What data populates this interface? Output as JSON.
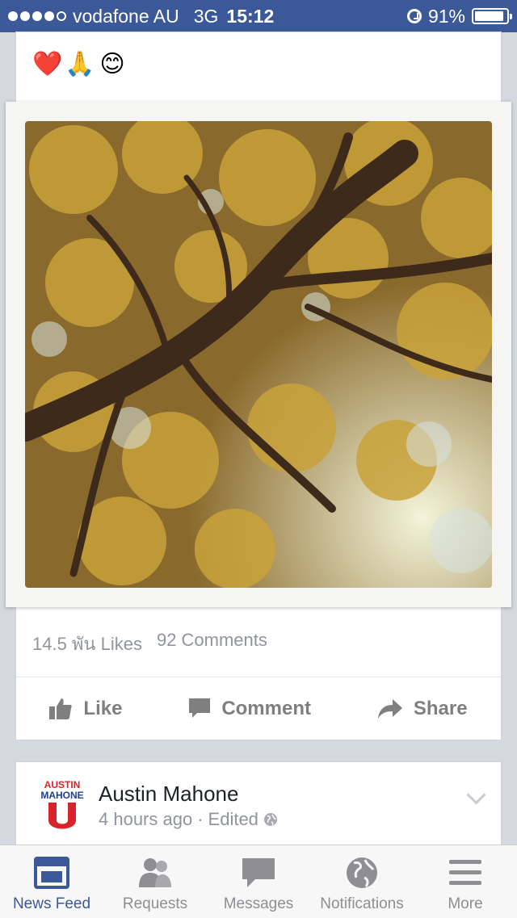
{
  "status_bar": {
    "carrier": "vodafone AU",
    "network": "3G",
    "time": "15:12",
    "battery": "91%",
    "battery_level": 0.91,
    "signal_strength": 4,
    "signal_max": 5,
    "alarm_icon": "alarm-clock-icon"
  },
  "post_top": {
    "emojis": [
      "❤️",
      "🙏",
      "😊"
    ],
    "likes": "14.5 พัน Likes",
    "comments": "92 Comments",
    "actions": {
      "like_label": "Like",
      "comment_label": "Comment",
      "share_label": "Share"
    }
  },
  "post_next": {
    "author": "Austin Mahone",
    "time": "4 hours ago",
    "separator": "·",
    "edited": "Edited",
    "avatar_text_top": "AUSTIN",
    "avatar_text_bottom": "MAHONE",
    "avatar_letter": "U"
  },
  "tabbar": {
    "tabs": [
      {
        "label": "News Feed",
        "icon": "news-feed-icon",
        "active": true
      },
      {
        "label": "Requests",
        "icon": "friend-requests-icon",
        "active": false
      },
      {
        "label": "Messages",
        "icon": "messages-icon",
        "active": false
      },
      {
        "label": "Notifications",
        "icon": "globe-icon",
        "active": false
      },
      {
        "label": "More",
        "icon": "menu-icon",
        "active": false
      }
    ]
  },
  "colors": {
    "brand": "#3b5998",
    "inactive": "#8e8e93",
    "muted_text": "#90949c",
    "action_text": "#7f7f7f"
  }
}
